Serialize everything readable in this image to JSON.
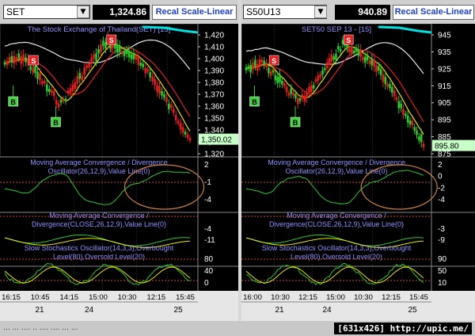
{
  "left": {
    "symbol": "SET",
    "price": "1,324.86",
    "recal_label": "Recal Scale-Linear",
    "chart_title": "The Stock Exchange of Thailand(SET) [15]",
    "last_price": "1,350.02",
    "price_ticks": [
      "1,420",
      "1,410",
      "1,400",
      "1,390",
      "1,380",
      "1,370",
      "1,360",
      "1,350",
      "1,340",
      "1,330",
      "1,320"
    ],
    "macd1_title": [
      "Moving Average Convergence / Divergence",
      "Oscillator(26,12,9),Value Line(0)"
    ],
    "macd1_ticks": [
      "2",
      "-1",
      "-4"
    ],
    "macd2_title": [
      "Moving Average Convergence /",
      "Divergence(CLOSE,26,12,9),Value Line(0)"
    ],
    "macd2_ticks": [
      "-4",
      "-11"
    ],
    "stoch_title": [
      "Slow Stochastics Oscillator(14,3,3),Overbought",
      "Level(80),Oversold Level(20)"
    ],
    "stoch_ticks": [
      "80",
      "40",
      "0"
    ],
    "time_labels": [
      "16:15",
      "10:45",
      "14:15",
      "15:00",
      "10:30",
      "12:15",
      "15:45"
    ],
    "day_labels": [
      "21",
      "24",
      "25"
    ],
    "signals": [
      "S",
      "S",
      "B",
      "B"
    ]
  },
  "right": {
    "symbol": "S50U13",
    "price": "940.89",
    "recal_label": "Recal Scale-Linear",
    "chart_title": "SET50 SEP 13 - [15]",
    "last_price": "895.80",
    "price_ticks": [
      "945",
      "935",
      "925",
      "915",
      "905",
      "895",
      "885",
      "875"
    ],
    "macd1_title": [
      "Moving Average Convergence / Divergence",
      "Oscillator(26,12,9),Value Line(0)"
    ],
    "macd1_ticks": [
      "2",
      "0",
      "-2",
      "-4"
    ],
    "macd2_title": [
      "Moving Average Convergence /",
      "Divergence(CLOSE,26,12,9),Value Line(0)"
    ],
    "macd2_ticks": [
      "-3",
      "-9"
    ],
    "stoch_title": [
      "Slow Stochastics Oscillator(14,3,3),Overbought",
      "Level(80),Oversold Level(20)"
    ],
    "stoch_ticks": [
      "90",
      "50",
      "10"
    ],
    "time_labels": [
      "16:00",
      "10:30",
      "12:15",
      "15:00",
      "10:30",
      "12:15",
      "15:45"
    ],
    "day_labels": [
      "21",
      "24",
      "25"
    ],
    "signals": [
      "S",
      "S",
      "B",
      "B"
    ]
  },
  "status": {
    "resolution": "[631x426] http://upic.me/",
    "blurred_text": "...  ...  .... ..  .... .... ... ..."
  },
  "colors": {
    "price_line": "#ffffff",
    "ma_red": "#e02020",
    "ma_yellow": "#e8e800",
    "up_candle": "#2ec82e",
    "down_candle": "#e02020",
    "grid": "#333333",
    "dotted_line": "#d04040",
    "cyan_line": "#00e0e0",
    "annotation_circle": "#d08040"
  }
}
